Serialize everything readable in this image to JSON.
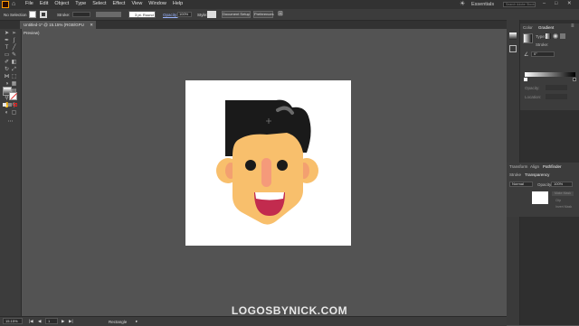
{
  "menubar": {
    "items": [
      "File",
      "Edit",
      "Object",
      "Type",
      "Select",
      "Effect",
      "View",
      "Window",
      "Help"
    ],
    "workspace": "Essentials",
    "search_placeholder": "Search Adobe Stock"
  },
  "control_bar": {
    "selection_label": "No Selection",
    "stroke_label": "Stroke:",
    "brush_label": "3 pt. Round",
    "opacity_label": "Opacity:",
    "opacity_value": "100%",
    "style_label": "Style:",
    "document_setup_label": "Document Setup",
    "preferences_label": "Preferences"
  },
  "document_tab": {
    "title": "Untitled-1* @ 15.15% (RGB/GPU Preview)"
  },
  "right_panels": {
    "top_tabs": [
      "Color",
      "Gradient"
    ],
    "gradient_type_label": "Type:",
    "stroke_label": "Stroke:",
    "angle_value": "0°",
    "opacity_label": "Opacity:",
    "location_label": "Location:",
    "bottom_tabs": [
      "Transform",
      "Align",
      "Pathfinder"
    ],
    "bottom_tabs2": [
      "Stroke",
      "Transparency"
    ],
    "blend_mode": "Normal",
    "trans_opacity_label": "Opacity:",
    "trans_opacity_value": "100%",
    "make_mask_label": "Make Mask",
    "clip_label": "Clip",
    "invert_mask_label": "Invert Mask"
  },
  "status_bar": {
    "zoom": "15.15%",
    "artboard_num": "1",
    "tool_name": "Rectangle"
  },
  "watermark": "LOGOSBYNICK.COM",
  "colors": {
    "skin": "#f8bf6c",
    "hair": "#1a1a1a",
    "nose": "#f59a7a",
    "cheek": "#f3a070",
    "mouth": "#c22b4e",
    "ui_bg": "#535353"
  }
}
